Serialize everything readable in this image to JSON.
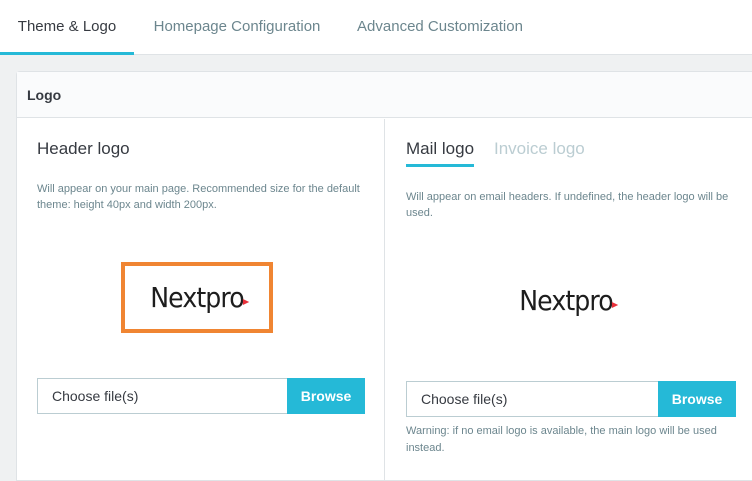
{
  "tabs": [
    {
      "label": "Theme & Logo"
    },
    {
      "label": "Homepage Configuration"
    },
    {
      "label": "Advanced Customization"
    }
  ],
  "card": {
    "title": "Logo"
  },
  "header_logo": {
    "title": "Header logo",
    "description": "Will appear on your main page. Recommended size for the default theme: height 40px and width 200px.",
    "logo_text": "Nextpro",
    "file_label": "Choose file(s)",
    "browse_label": "Browse"
  },
  "mail_logo": {
    "tab_mail": "Mail logo",
    "tab_invoice": "Invoice logo",
    "description": "Will appear on email headers. If undefined, the header logo will be used.",
    "logo_text": "Nextpro",
    "file_label": "Choose file(s)",
    "browse_label": "Browse",
    "warning": "Warning: if no email logo is available, the main logo will be used instead."
  },
  "colors": {
    "accent": "#25b9d7",
    "highlight_border": "#f08532",
    "logo_mark": "#e8303a"
  }
}
